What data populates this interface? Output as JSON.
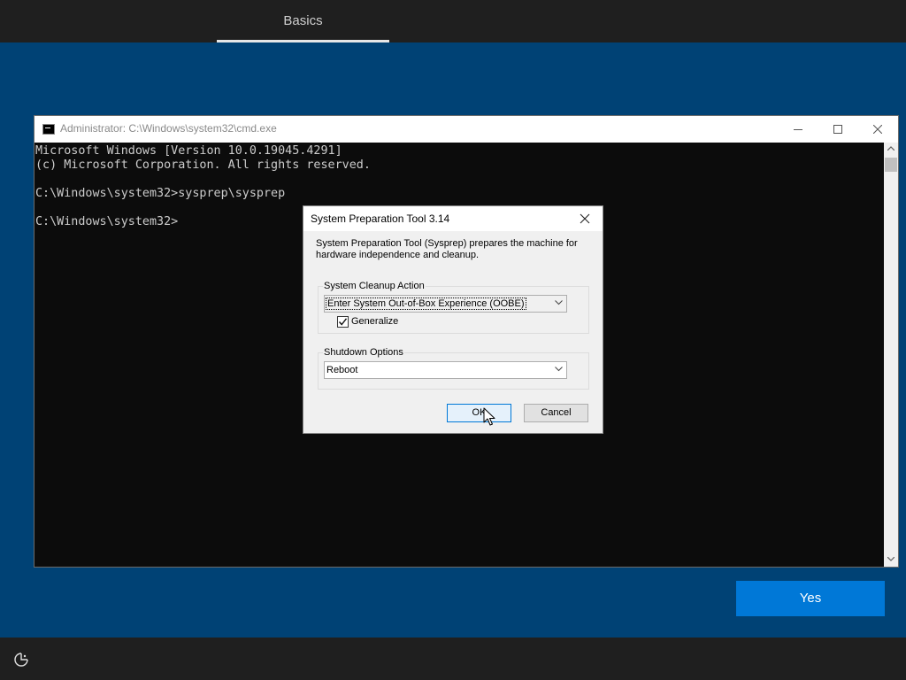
{
  "oobe": {
    "tab_label": "Basics",
    "yes_label": "Yes",
    "icons": {
      "accessibility": "accessibility-icon"
    }
  },
  "cmd": {
    "title": "Administrator: C:\\Windows\\system32\\cmd.exe",
    "lines": [
      "Microsoft Windows [Version 10.0.19045.4291]",
      "(c) Microsoft Corporation. All rights reserved.",
      "",
      "C:\\Windows\\system32>sysprep\\sysprep",
      "",
      "C:\\Windows\\system32>"
    ]
  },
  "dialog": {
    "title": "System Preparation Tool 3.14",
    "description": "System Preparation Tool (Sysprep) prepares the machine for hardware independence and cleanup.",
    "cleanup_group_label": "System Cleanup Action",
    "cleanup_selected": "Enter System Out-of-Box Experience (OOBE)",
    "generalize_label": "Generalize",
    "generalize_checked": true,
    "shutdown_group_label": "Shutdown Options",
    "shutdown_selected": "Reboot",
    "ok_label": "OK",
    "cancel_label": "Cancel"
  },
  "colors": {
    "desktop": "#004275",
    "oobe_bar": "#1f1f1f",
    "accent": "#0078d7",
    "console_bg": "#0c0c0c",
    "console_text": "#cccccc"
  }
}
